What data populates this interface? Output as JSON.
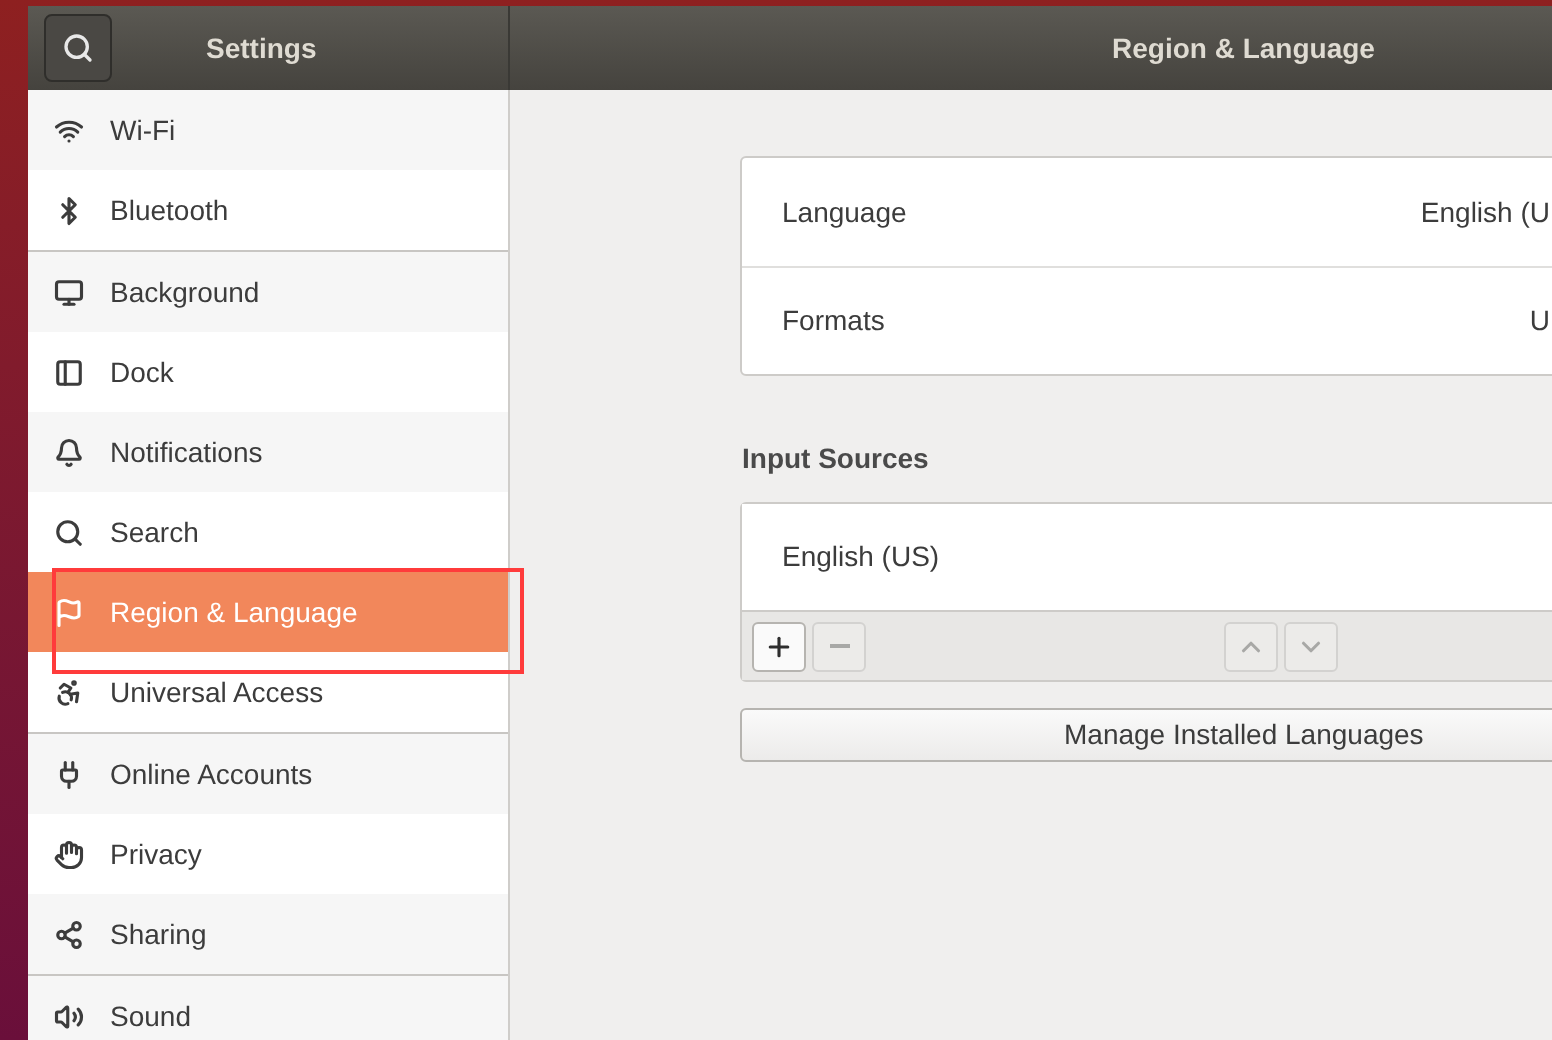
{
  "sidebar": {
    "title": "Settings",
    "groups": [
      {
        "items": [
          {
            "label": "Wi-Fi",
            "selected": false
          },
          {
            "label": "Bluetooth",
            "selected": false
          }
        ]
      },
      {
        "items": [
          {
            "label": "Background",
            "selected": false
          },
          {
            "label": "Dock",
            "selected": false
          },
          {
            "label": "Notifications",
            "selected": false
          },
          {
            "label": "Search",
            "selected": false
          },
          {
            "label": "Region & Language",
            "selected": true
          },
          {
            "label": "Universal Access",
            "selected": false
          }
        ]
      },
      {
        "items": [
          {
            "label": "Online Accounts",
            "selected": false
          },
          {
            "label": "Privacy",
            "selected": false
          },
          {
            "label": "Sharing",
            "selected": false
          }
        ]
      },
      {
        "items": [
          {
            "label": "Sound",
            "selected": false
          }
        ]
      }
    ]
  },
  "page": {
    "title": "Region & Language",
    "settings": [
      {
        "label": "Language",
        "value": "English (U"
      },
      {
        "label": "Formats",
        "value": "U"
      }
    ],
    "input_sources": {
      "heading": "Input Sources",
      "items": [
        "English (US)"
      ],
      "toolbar": [
        {
          "kind": "add",
          "disabled": false
        },
        {
          "kind": "remove",
          "disabled": true
        },
        {
          "kind": "move-up",
          "disabled": true
        },
        {
          "kind": "move-down",
          "disabled": true
        }
      ]
    },
    "manage_button": "Manage Installed Languages"
  }
}
